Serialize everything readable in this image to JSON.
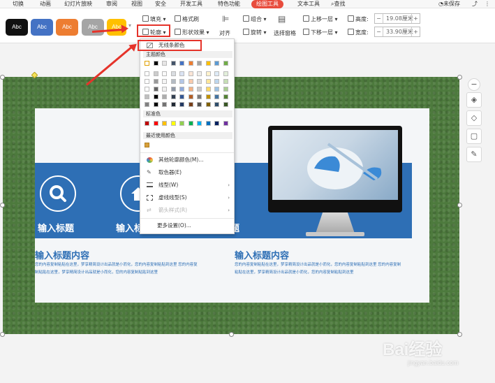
{
  "menu": {
    "items": [
      "切换",
      "动画",
      "幻灯片放映",
      "审阅",
      "视图",
      "安全",
      "开发工具",
      "特色功能",
      "绘图工具",
      "文本工具"
    ],
    "search": "查找",
    "sync": "未保存"
  },
  "ribbon": {
    "styles": [
      {
        "label": "Abc",
        "color": "#111111"
      },
      {
        "label": "Abc",
        "color": "#4472c4"
      },
      {
        "label": "Abc",
        "color": "#ed7d31"
      },
      {
        "label": "Abc",
        "color": "#a5a5a5"
      },
      {
        "label": "Abc",
        "color": "#ffc000"
      }
    ],
    "fill": "填充",
    "format_brush": "格式刷",
    "outline": "轮廓",
    "shape_effect": "形状效果",
    "align": "对齐",
    "group": "组合",
    "rotate": "旋转",
    "selection_pane": "选择窗格",
    "bring_forward": "上移一层",
    "send_backward": "下移一层",
    "height_label": "高度:",
    "height_value": "19.08厘米",
    "width_label": "宽度:",
    "width_value": "33.90厘米"
  },
  "dropdown": {
    "no_outline": "无线条颜色",
    "theme_colors": "主题颜色",
    "standard_colors": "标准色",
    "recent_colors": "最近使用颜色",
    "more_colors": "其他轮廓颜色(M)...",
    "eyedropper": "取色器(E)",
    "line_type": "线型(W)",
    "dash_type": "虚线线型(S)",
    "arrow_style": "箭头样式(R)",
    "more_settings": "更多设置(O)..."
  },
  "slide": {
    "band_label_1": "输入标题",
    "band_label_2": "输入标",
    "band_label_3": "题",
    "heading_left": "输入标题内容",
    "heading_right": "输入标题内容",
    "body_left": "您的内容复制粘贴在这里，梦享精简设计出品就是小而化，您的内容复制粘贴到这里 您的内容复制粘贴在这里，梦享精简设计出品就是小而化，您的内容复制粘贴到这里",
    "body_right": "您的内容复制粘贴在这里，梦享精简设计出品就是小而化，您的内容复制粘贴到这里 您的内容复制粘贴在这里，梦享精简设计出品就是小而化，您的内容复制粘贴到这里"
  },
  "watermark": {
    "brand": "Bai经验",
    "url": "jingyan.baidu.com"
  },
  "colors": {
    "accent_red": "#e5332a",
    "slide_blue": "#2e6fb5",
    "background_green": "#4d7a3d",
    "tab_active": "#e84c3d"
  }
}
